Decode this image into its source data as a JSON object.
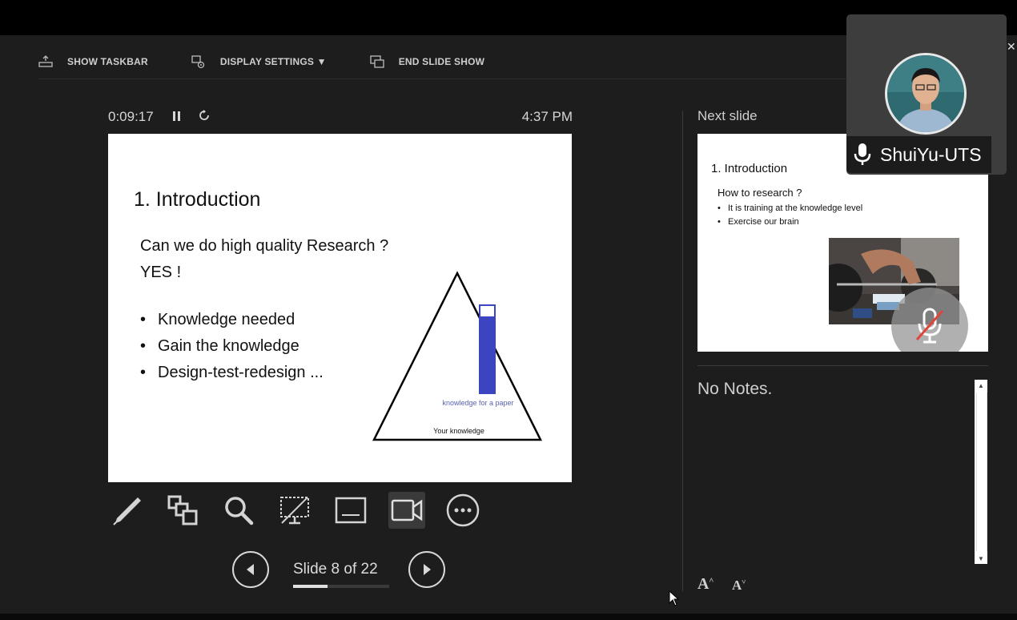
{
  "toolbar": {
    "show_taskbar": "SHOW TASKBAR",
    "display_settings": "DISPLAY SETTINGS ▼",
    "end_slide_show": "END SLIDE SHOW"
  },
  "presenter": {
    "elapsed_time": "0:09:17",
    "clock": "4:37 PM",
    "next_slide_label": "Next slide",
    "notes": "No Notes.",
    "slide_counter": "Slide 8 of 22",
    "progress_fraction": 0.36
  },
  "current_slide": {
    "title": "1. Introduction",
    "question_line1": "Can we do high quality Research ?",
    "question_line2": "YES !",
    "bullets": [
      "Knowledge needed",
      "Gain the knowledge",
      "Design-test-redesign ..."
    ],
    "diagram_inner_label": "knowledge for a paper",
    "diagram_base_label": "Your knowledge"
  },
  "next_slide": {
    "title": "1. Introduction",
    "subtitle": "How to research ?",
    "bullets": [
      "It is training at the knowledge level",
      "Exercise our brain"
    ]
  },
  "participant": {
    "name": "ShuiYu-UTS"
  },
  "colors": {
    "background": "#1d1d1d",
    "diagram_bar": "#3d44c0",
    "diagram_label": "#5a63b5"
  }
}
